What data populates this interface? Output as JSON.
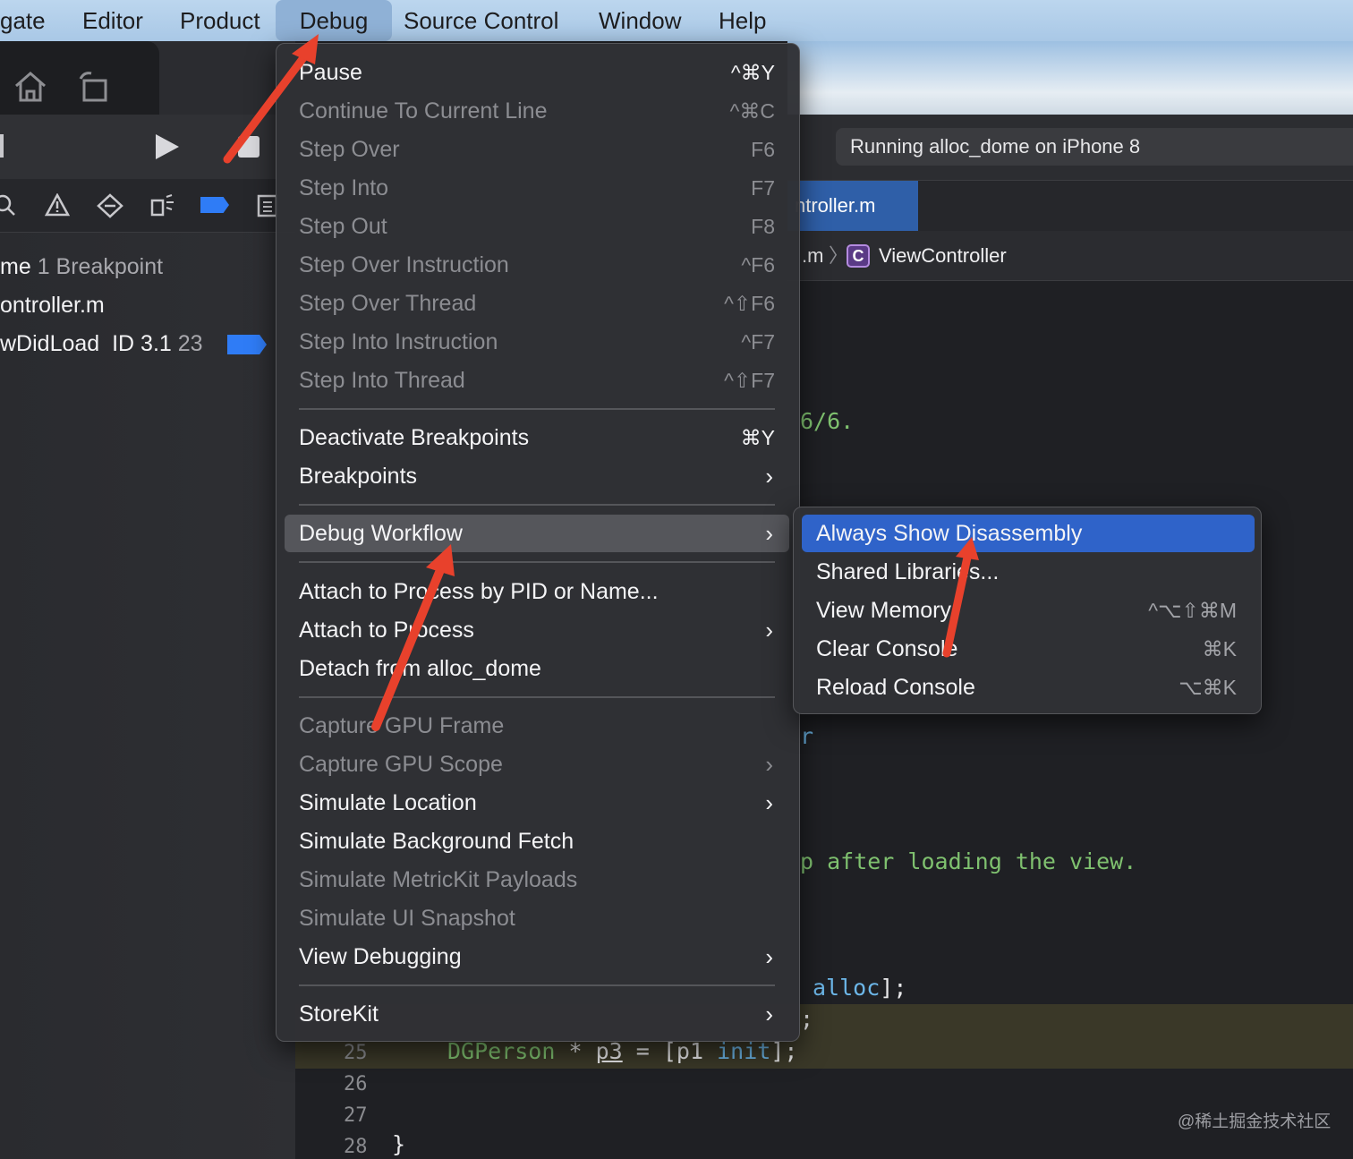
{
  "menubar": {
    "items": [
      "gate",
      "Editor",
      "Product",
      "Debug",
      "Source Control",
      "Window",
      "Help"
    ]
  },
  "navigator": {
    "row1_name": "me",
    "row1_count": "1 Breakpoint",
    "row2": "ontroller.m",
    "row3_name": "wDidLoad",
    "row3_id": "ID 3.1",
    "row3_line": "23"
  },
  "editor": {
    "status": "Running alloc_dome on iPhone 8",
    "tab": "ntroller.m",
    "jump_file": ".m",
    "jump_class_icon": "C",
    "jump_class": "ViewController",
    "code_fragments": {
      "date": "6/6.",
      "r": "r",
      "comment": "p after loading the view.",
      "alloc_msg": "alloc",
      "alloc_end": "];",
      "semi": ";",
      "line25_type": "DGPerson",
      "line25_star": "*",
      "line25_var": "p3",
      "line25_eq": "= [p1",
      "line25_msg": "init",
      "line25_end": "];",
      "line28": "}"
    },
    "line_numbers": [
      "25",
      "26",
      "27",
      "28"
    ]
  },
  "debug_menu": {
    "items": [
      {
        "label": "Pause",
        "shortcut": "^⌘Y",
        "enabled": true
      },
      {
        "label": "Continue To Current Line",
        "shortcut": "^⌘C",
        "enabled": false
      },
      {
        "label": "Step Over",
        "shortcut": "F6",
        "enabled": false
      },
      {
        "label": "Step Into",
        "shortcut": "F7",
        "enabled": false
      },
      {
        "label": "Step Out",
        "shortcut": "F8",
        "enabled": false
      },
      {
        "label": "Step Over Instruction",
        "shortcut": "^F6",
        "enabled": false
      },
      {
        "label": "Step Over Thread",
        "shortcut": "^⇧F6",
        "enabled": false
      },
      {
        "label": "Step Into Instruction",
        "shortcut": "^F7",
        "enabled": false
      },
      {
        "label": "Step Into Thread",
        "shortcut": "^⇧F7",
        "enabled": false
      },
      {
        "label": "Deactivate Breakpoints",
        "shortcut": "⌘Y",
        "enabled": true
      },
      {
        "label": "Breakpoints",
        "shortcut": "›",
        "enabled": true
      },
      {
        "label": "Debug Workflow",
        "shortcut": "›",
        "enabled": true
      },
      {
        "label": "Attach to Process by PID or Name...",
        "shortcut": "",
        "enabled": true
      },
      {
        "label": "Attach to Process",
        "shortcut": "›",
        "enabled": true
      },
      {
        "label": "Detach from alloc_dome",
        "shortcut": "",
        "enabled": true
      },
      {
        "label": "Capture GPU Frame",
        "shortcut": "",
        "enabled": false
      },
      {
        "label": "Capture GPU Scope",
        "shortcut": "›",
        "enabled": false
      },
      {
        "label": "Simulate Location",
        "shortcut": "›",
        "enabled": true
      },
      {
        "label": "Simulate Background Fetch",
        "shortcut": "",
        "enabled": true
      },
      {
        "label": "Simulate MetricKit Payloads",
        "shortcut": "",
        "enabled": false
      },
      {
        "label": "Simulate UI Snapshot",
        "shortcut": "",
        "enabled": false
      },
      {
        "label": "View Debugging",
        "shortcut": "›",
        "enabled": true
      },
      {
        "label": "StoreKit",
        "shortcut": "›",
        "enabled": true
      }
    ]
  },
  "workflow_submenu": {
    "items": [
      {
        "label": "Always Show Disassembly",
        "shortcut": ""
      },
      {
        "label": "Shared Libraries...",
        "shortcut": ""
      },
      {
        "label": "View Memory",
        "shortcut": "^⌥⇧⌘M"
      },
      {
        "label": "Clear Console",
        "shortcut": "⌘K"
      },
      {
        "label": "Reload Console",
        "shortcut": "⌥⌘K"
      }
    ]
  },
  "colors": {
    "selection": "#2f63c9",
    "annotation_arrow": "#e8412c",
    "string_green": "#7fc16f",
    "keyword_blue": "#6cb6e8"
  },
  "watermark": "@稀土掘金技术社区"
}
